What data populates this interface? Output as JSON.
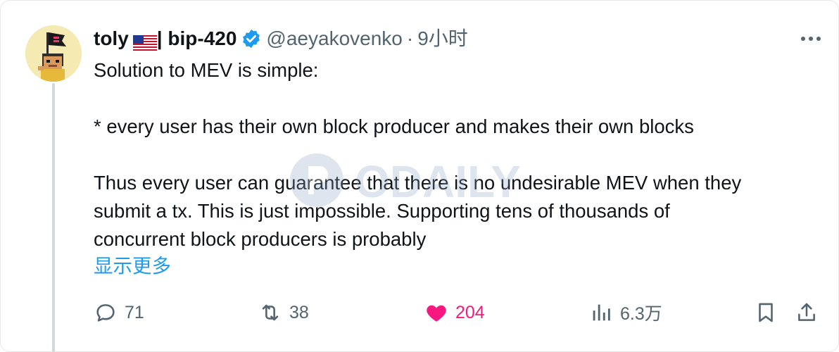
{
  "tweet": {
    "author": {
      "display_name": "toly",
      "name_suffix": "| bip-420",
      "handle": "@aeyakovenko",
      "separator": "·",
      "time": "9小时",
      "flag_icon": "us-flag-icon",
      "verified": true
    },
    "body_lines": [
      "Solution to MEV is simple:",
      "* every user has their own block producer and makes their own blocks",
      "Thus every user can guarantee that there is no undesirable MEV when they",
      "submit a tx. This is just impossible.  Supporting tens of thousands of",
      "concurrent block producers is probably"
    ],
    "show_more": "显示更多",
    "watermark_text": "ODAILY",
    "actions": {
      "reply_count": "71",
      "retweet_count": "38",
      "like_count": "204",
      "views_count": "6.3万"
    }
  },
  "colors": {
    "text": "#0f1419",
    "secondary": "#536471",
    "link": "#1d9bf0",
    "like": "#f91880",
    "thread_line": "#cfd9de",
    "verified": "#1d9bf0"
  }
}
